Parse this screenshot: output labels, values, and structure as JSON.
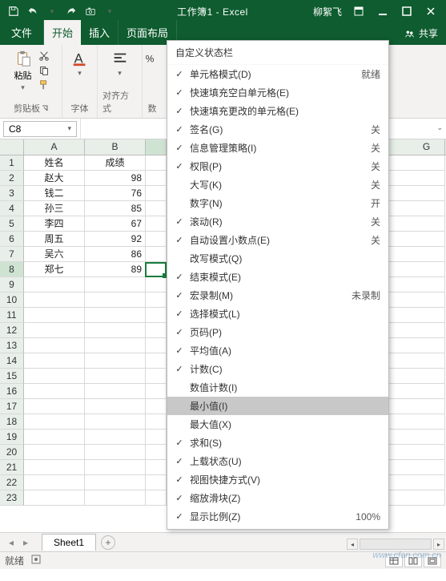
{
  "title": "工作簿1 - Excel",
  "user": "柳絮飞",
  "tabs": {
    "file": "文件",
    "home": "开始",
    "insert": "插入",
    "layout": "页面布局",
    "share": "共享"
  },
  "groups": {
    "clipboard": "剪贴板",
    "paste": "粘贴",
    "font": "字体",
    "align": "对齐方式",
    "number": "数"
  },
  "namebox": "C8",
  "columns": [
    "A",
    "B",
    "G"
  ],
  "data_rows": [
    {
      "n": "1",
      "a": "姓名",
      "b": "成绩"
    },
    {
      "n": "2",
      "a": "赵大",
      "b": "98"
    },
    {
      "n": "3",
      "a": "钱二",
      "b": "76"
    },
    {
      "n": "4",
      "a": "孙三",
      "b": "85"
    },
    {
      "n": "5",
      "a": "李四",
      "b": "67"
    },
    {
      "n": "6",
      "a": "周五",
      "b": "92"
    },
    {
      "n": "7",
      "a": "吴六",
      "b": "86"
    },
    {
      "n": "8",
      "a": "郑七",
      "b": "89"
    }
  ],
  "empty_rows": [
    "9",
    "10",
    "11",
    "12",
    "13",
    "14",
    "15",
    "16",
    "17",
    "18",
    "19",
    "20",
    "21",
    "22",
    "23"
  ],
  "sheet": {
    "name": "Sheet1"
  },
  "status": {
    "ready": "就绪"
  },
  "ctx": {
    "title": "自定义状态栏",
    "items": [
      {
        "chk": true,
        "label": "单元格模式(D)",
        "st": "就绪"
      },
      {
        "chk": true,
        "label": "快速填充空白单元格(E)",
        "st": ""
      },
      {
        "chk": true,
        "label": "快速填充更改的单元格(E)",
        "st": ""
      },
      {
        "chk": true,
        "label": "签名(G)",
        "st": "关"
      },
      {
        "chk": true,
        "label": "信息管理策略(I)",
        "st": "关"
      },
      {
        "chk": true,
        "label": "权限(P)",
        "st": "关"
      },
      {
        "chk": false,
        "label": "大写(K)",
        "st": "关"
      },
      {
        "chk": false,
        "label": "数字(N)",
        "st": "开"
      },
      {
        "chk": true,
        "label": "滚动(R)",
        "st": "关"
      },
      {
        "chk": true,
        "label": "自动设置小数点(E)",
        "st": "关"
      },
      {
        "chk": false,
        "label": "改写模式(Q)",
        "st": ""
      },
      {
        "chk": true,
        "label": "结束模式(E)",
        "st": ""
      },
      {
        "chk": true,
        "label": "宏录制(M)",
        "st": "未录制"
      },
      {
        "chk": true,
        "label": "选择模式(L)",
        "st": ""
      },
      {
        "chk": true,
        "label": "页码(P)",
        "st": ""
      },
      {
        "chk": true,
        "label": "平均值(A)",
        "st": ""
      },
      {
        "chk": true,
        "label": "计数(C)",
        "st": ""
      },
      {
        "chk": false,
        "label": "数值计数(I)",
        "st": ""
      },
      {
        "chk": false,
        "label": "最小值(I)",
        "st": "",
        "hover": true
      },
      {
        "chk": false,
        "label": "最大值(X)",
        "st": ""
      },
      {
        "chk": true,
        "label": "求和(S)",
        "st": ""
      },
      {
        "chk": true,
        "label": "上载状态(U)",
        "st": ""
      },
      {
        "chk": true,
        "label": "视图快捷方式(V)",
        "st": ""
      },
      {
        "chk": true,
        "label": "缩放滑块(Z)",
        "st": ""
      },
      {
        "chk": true,
        "label": "显示比例(Z)",
        "st": "100%"
      }
    ]
  },
  "watermark": "www.cfan.com.cn"
}
